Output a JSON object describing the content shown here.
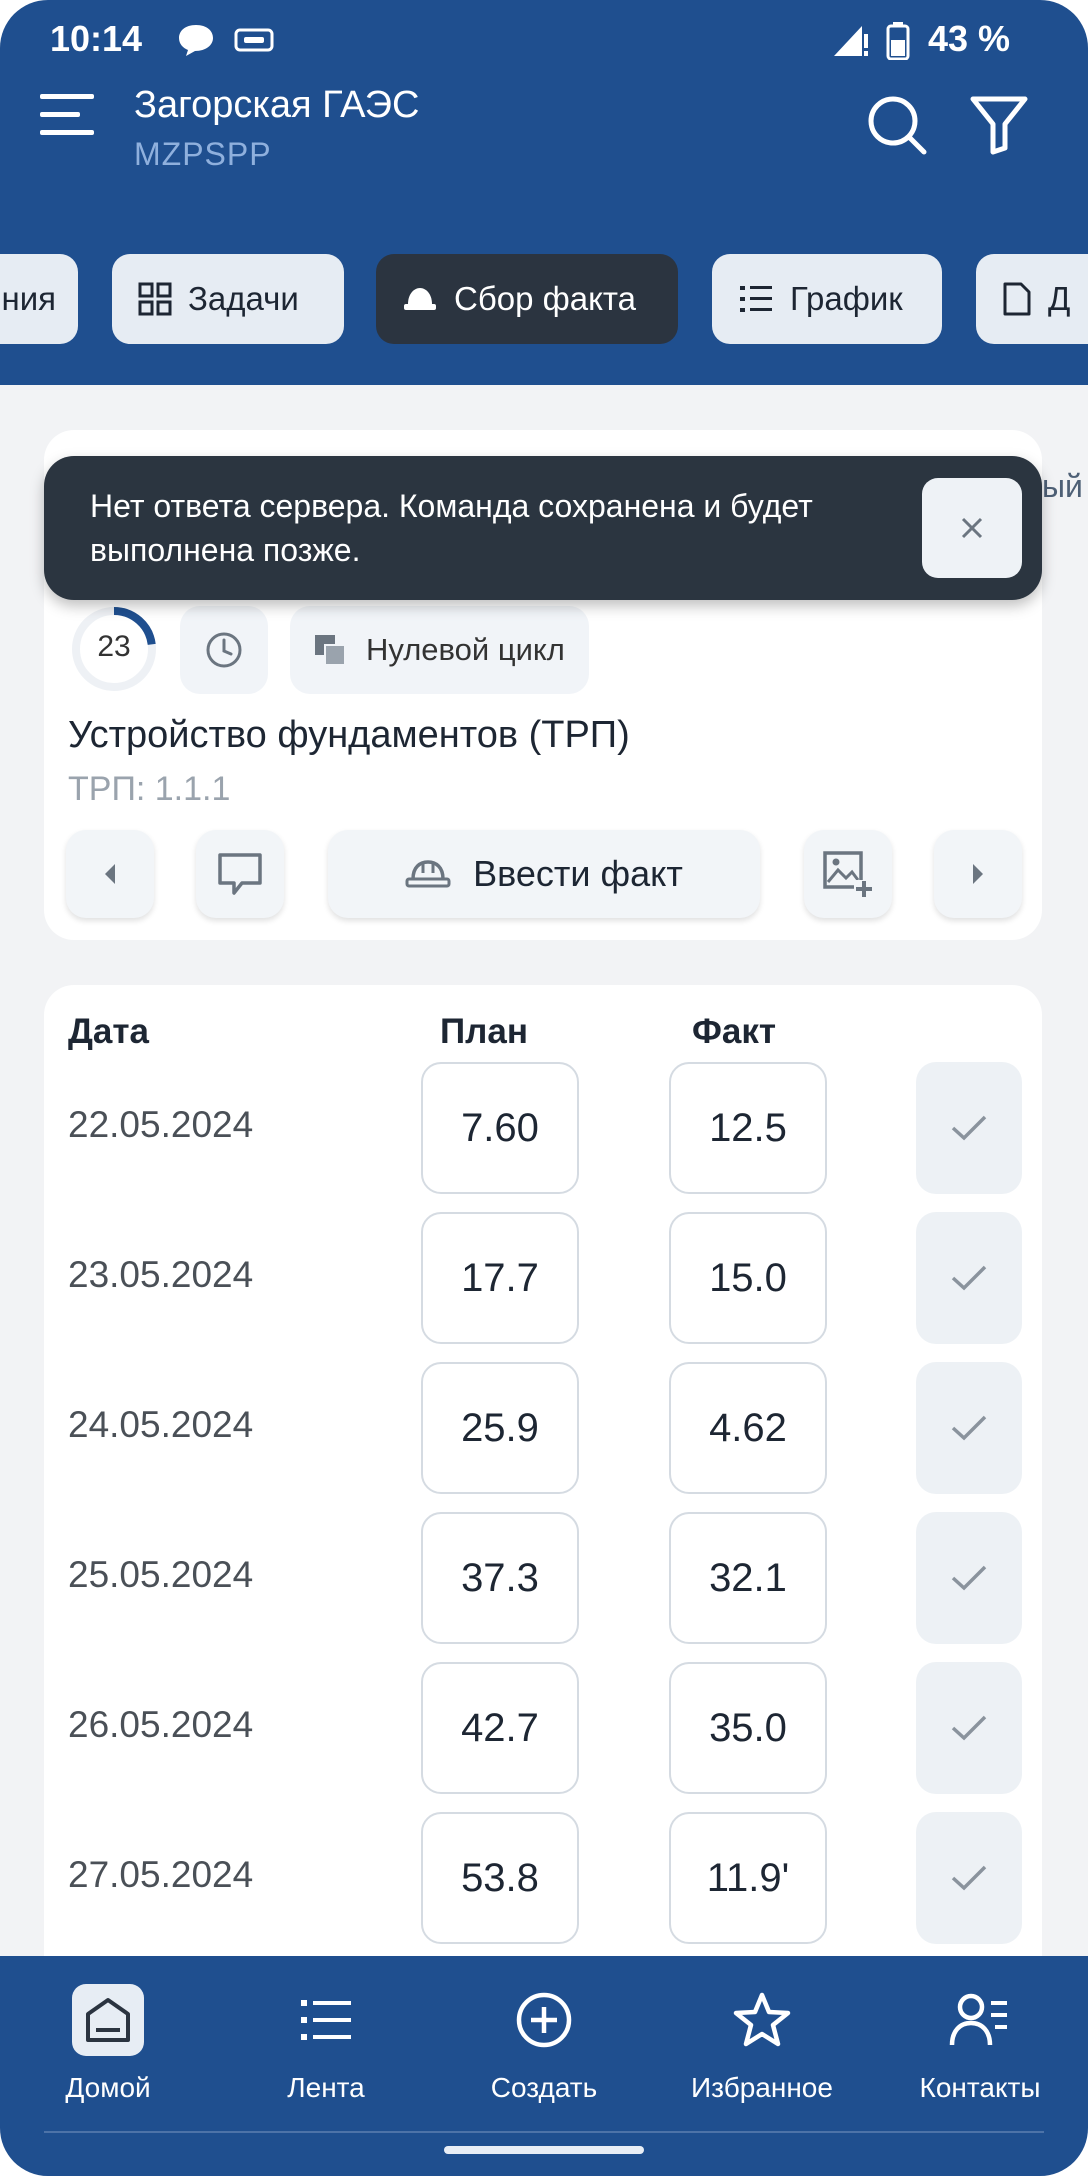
{
  "status_bar": {
    "time": "10:14",
    "battery": "43 %"
  },
  "app": {
    "title": "Загорская ГАЭС",
    "subtitle": "MZPSPP"
  },
  "tabs": [
    {
      "label": "ния",
      "icon": "none",
      "active": false
    },
    {
      "label": "Задачи",
      "icon": "grid-icon",
      "active": false
    },
    {
      "label": "Сбор факта",
      "icon": "helmet-icon",
      "active": true
    },
    {
      "label": "График",
      "icon": "list-icon",
      "active": false
    },
    {
      "label": "Д",
      "icon": "document-icon",
      "active": false
    }
  ],
  "toast": {
    "message": "Нет ответа сервера. Команда сохранена и будет выполнена позже."
  },
  "card_edge_text": "ый",
  "task": {
    "progress": "23",
    "progress_fraction": 0.23,
    "stage": "Нулевой цикл",
    "title": "Устройство фундаментов (ТРП)",
    "code": "ТРП: 1.1.1",
    "enter_fact_label": "Ввести факт"
  },
  "table": {
    "headers": {
      "date": "Дата",
      "plan": "План",
      "fact": "Факт"
    },
    "rows": [
      {
        "date": "22.05.2024",
        "plan": "7.60",
        "fact": "12.5"
      },
      {
        "date": "23.05.2024",
        "plan": "17.7",
        "fact": "15.0"
      },
      {
        "date": "24.05.2024",
        "plan": "25.9",
        "fact": "4.62"
      },
      {
        "date": "25.05.2024",
        "plan": "37.3",
        "fact": "32.1"
      },
      {
        "date": "26.05.2024",
        "plan": "42.7",
        "fact": "35.0"
      },
      {
        "date": "27.05.2024",
        "plan": "53.8",
        "fact": "11.9'"
      }
    ]
  },
  "bottom_nav": [
    {
      "label": "Домой",
      "icon": "home-icon",
      "active": true
    },
    {
      "label": "Лента",
      "icon": "feed-icon",
      "active": false
    },
    {
      "label": "Создать",
      "icon": "plus-circle-icon",
      "active": false
    },
    {
      "label": "Избранное",
      "icon": "star-icon",
      "active": false
    },
    {
      "label": "Контакты",
      "icon": "contacts-icon",
      "active": false
    }
  ],
  "colors": {
    "header": "#1f4f8f",
    "active_tab": "#2b3440",
    "toast": "#2b3540",
    "progress_arc": "#1f4f8f"
  }
}
